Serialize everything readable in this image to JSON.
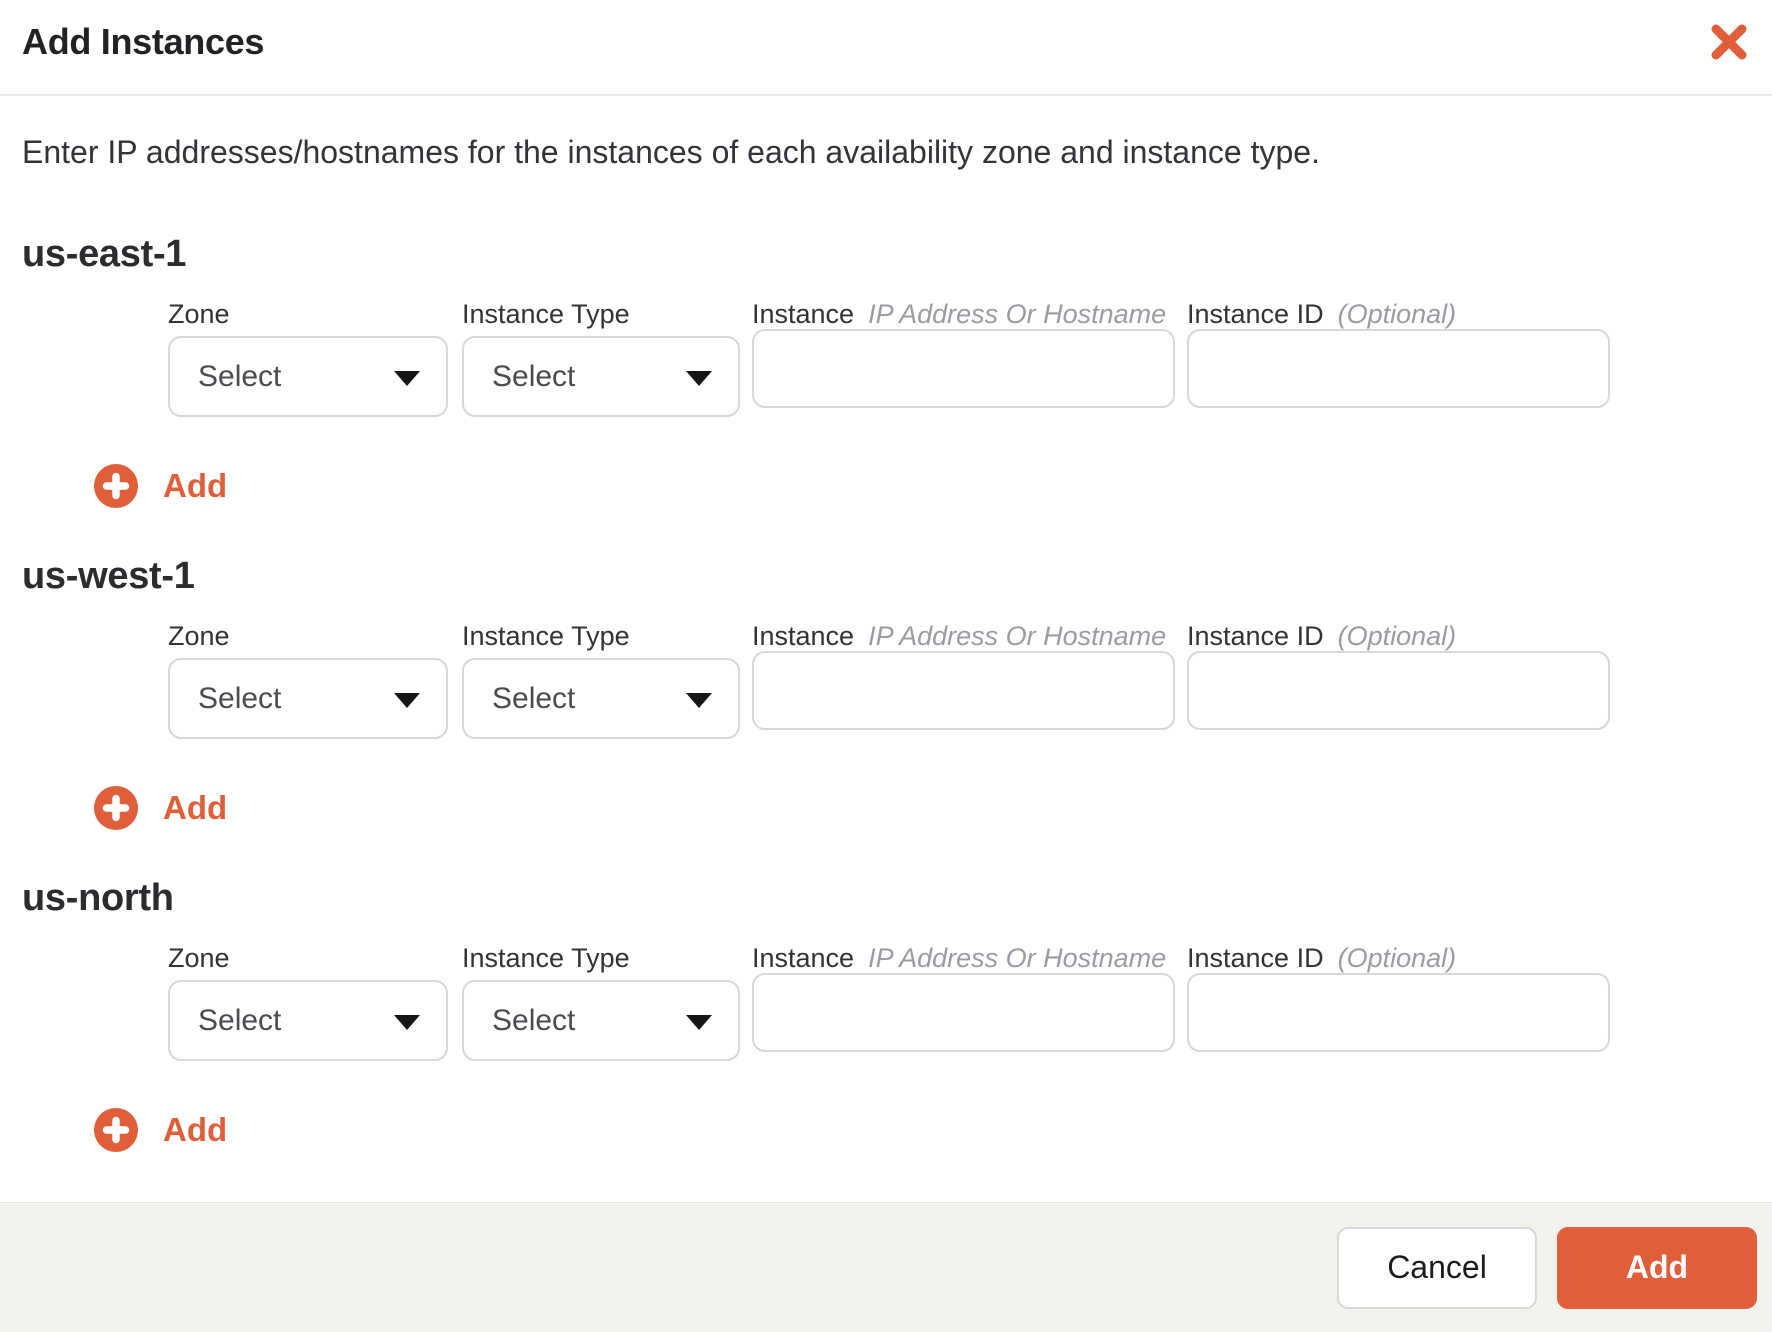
{
  "theme": {
    "accent": "#E05F3A",
    "footer-bg": "#F2F1EC",
    "border": "#D8D8DC",
    "text-dark": "#27272B",
    "text-muted": "#9B9CA3"
  },
  "modal": {
    "title": "Add Instances",
    "description": "Enter IP addresses/hostnames for the instances of each availability zone and instance type."
  },
  "fields": {
    "zone_label": "Zone",
    "instance_type_label": "Instance Type",
    "instance_label": "Instance",
    "instance_hint": "IP Address Or Hostname",
    "instance_id_label": "Instance ID",
    "instance_id_hint": "(Optional)",
    "select_placeholder": "Select"
  },
  "sections": [
    {
      "heading": "us-east-1",
      "add_label": "Add"
    },
    {
      "heading": "us-west-1",
      "add_label": "Add"
    },
    {
      "heading": "us-north",
      "add_label": "Add"
    }
  ],
  "footer": {
    "cancel_label": "Cancel",
    "add_label": "Add"
  },
  "icons": {
    "close": "x-icon",
    "add": "plus-circle-icon",
    "select_caret": "chevron-down-icon"
  }
}
